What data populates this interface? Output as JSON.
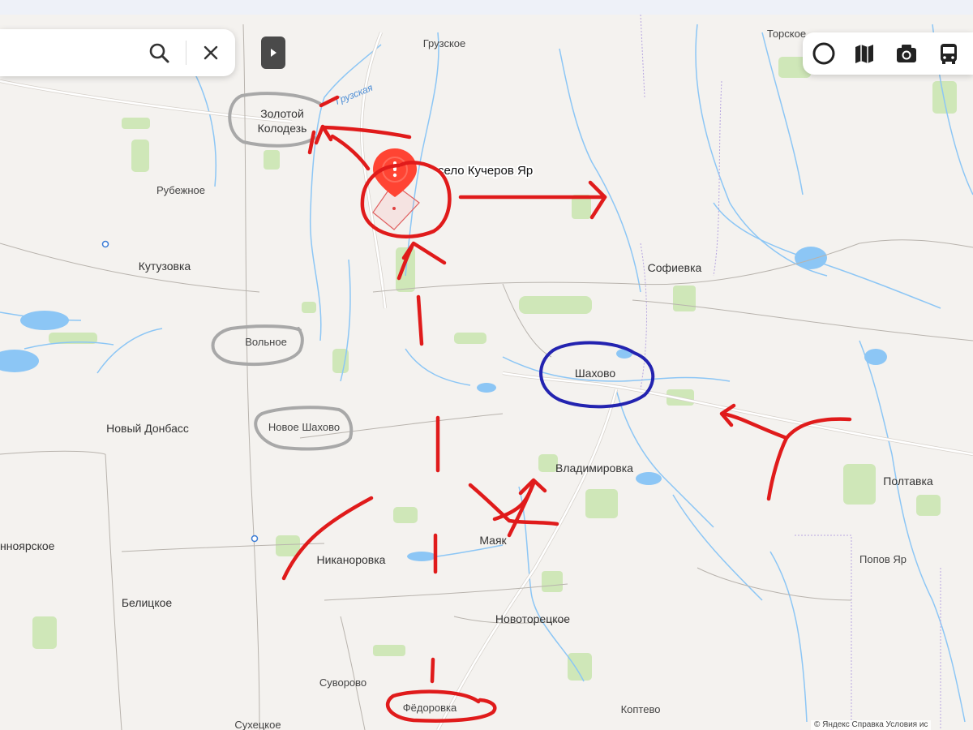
{
  "search": {
    "value": "",
    "placeholder": ""
  },
  "icons": {
    "search": "search-icon",
    "close": "close-icon",
    "collapse": "play-arrow-icon",
    "layers": [
      "cycle-layer-icon",
      "map-layer-icon",
      "camera-layer-icon",
      "bus-layer-icon"
    ]
  },
  "map": {
    "places": {
      "gruzskoe": "Грузское",
      "torskoe": "Торское",
      "river_gruzskaya": "Грузская",
      "zolotoy_1": "Золотой",
      "zolotoy_2": "Колодезь",
      "rubezhnoe": "Рубежное",
      "kutuzovka": "Кутузовка",
      "volnoe": "Вольное",
      "novy_donbass": "Новый Донбасс",
      "novoe_shakhovo": "Новое Шахово",
      "shakhovo": "Шахово",
      "sofievka": "Софиевка",
      "vladimirovka": "Владимировка",
      "poltavka": "Полтавка",
      "mayak": "Маяк",
      "nikanorovka": "Никаноровка",
      "belitskoe": "Белицкое",
      "noyarskoe": "нноярское",
      "novotoretskoe": "Новоторецкое",
      "popov_yar": "Попов Яр",
      "suvorovo": "Суворово",
      "fedorovka": "Фёдоровка",
      "koptevo": "Коптево",
      "sukhetskoe": "Сухецкое"
    },
    "pin_label": "село Кучеров Яр",
    "attribution": "© Яндекс  Справка  Условия ис"
  },
  "colors": {
    "map_bg": "#f4f2ef",
    "water": "#8cc6f5",
    "forest": "#c8e6b0",
    "road": "#ffffff",
    "annotation_red": "#e01b1b",
    "annotation_blue": "#2323b0",
    "annotation_gray": "#a8a8a8",
    "pin": "#ff4433"
  }
}
